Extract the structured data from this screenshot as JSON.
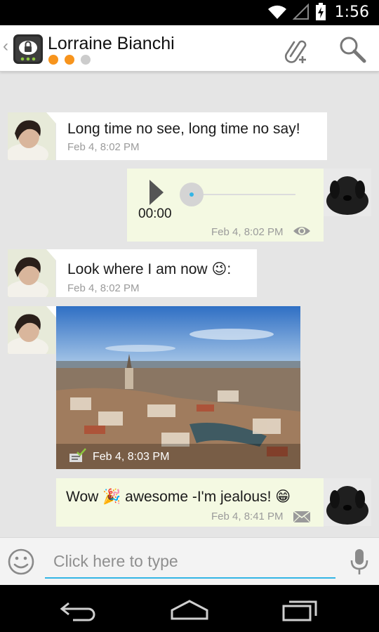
{
  "status_bar": {
    "time": "1:56",
    "icons": [
      "wifi-icon",
      "signal-icon",
      "battery-charging-icon"
    ]
  },
  "header": {
    "contact_name": "Lorraine Bianchi",
    "presence_dots": [
      "#f7941d",
      "#f7941d",
      "#cccccc"
    ],
    "actions": [
      "paperclip-add-icon",
      "search-icon"
    ]
  },
  "messages": [
    {
      "direction": "incoming",
      "type": "text",
      "text": "Long time no see, long time no say!",
      "time": "Feb 4, 8:02 PM"
    },
    {
      "direction": "outgoing",
      "type": "voice",
      "duration": "00:00",
      "progress": 0,
      "time": "Feb 4, 8:02 PM",
      "status_icon": "seen-eye-icon"
    },
    {
      "direction": "incoming",
      "type": "text",
      "text": "Look where I am now",
      "emoji": "😉",
      "suffix": ":",
      "time": "Feb 4, 8:02 PM"
    },
    {
      "direction": "incoming",
      "type": "image",
      "image_subject": "Zurich city skyline photo",
      "time": "Feb 4, 8:03 PM",
      "status_icon": "delivered-check-icon"
    },
    {
      "direction": "outgoing",
      "type": "text",
      "text_before": "Wow",
      "emoji1": "🎉",
      "text_after": "awesome -I'm jealous!",
      "emoji2": "😁",
      "time": "Feb 4, 8:41 PM",
      "status_icon": "envelope-icon"
    }
  ],
  "composer": {
    "placeholder": "Click here to type",
    "value": ""
  },
  "nav": [
    "back-icon",
    "home-icon",
    "recent-apps-icon"
  ],
  "colors": {
    "accent": "#33b5e5",
    "presence_active": "#f7941d",
    "incoming_bubble": "#ffffff",
    "outgoing_bubble": "#f4f9e2",
    "background": "#e5e5e5"
  }
}
